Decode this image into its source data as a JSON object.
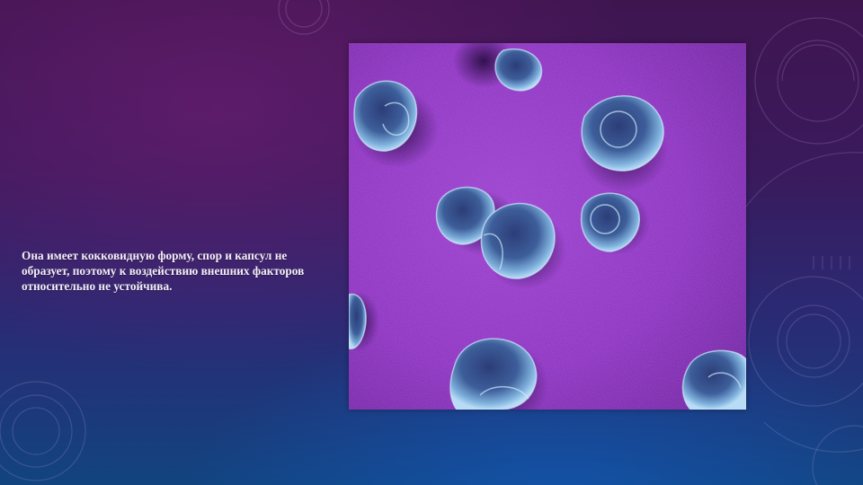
{
  "slide": {
    "body_text": "Она имеет кокковидную форму, спор и капсул не образует, поэтому к воздействию внешних факторов относительно не устойчива."
  },
  "image": {
    "icon": "micrograph-cocci",
    "background_color": "#8a2fc0",
    "cell_color": "#5a8fc0"
  }
}
